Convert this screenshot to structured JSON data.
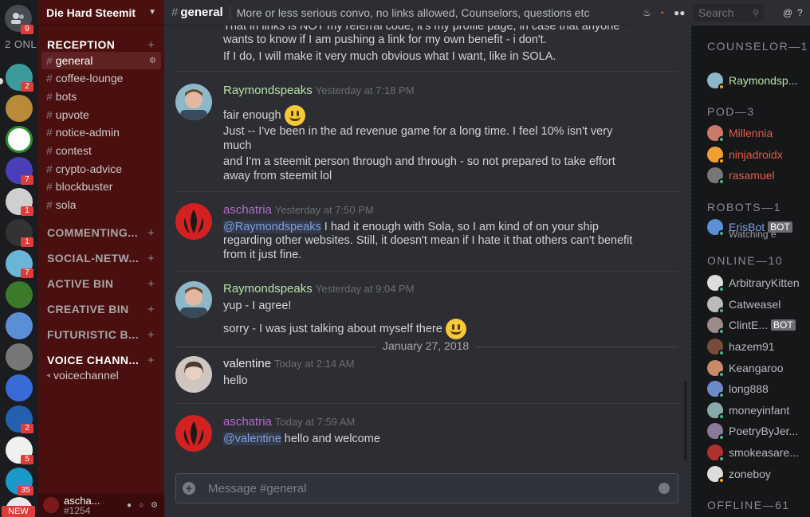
{
  "guilds": {
    "home_badge": "9",
    "online_label": "2 ONL",
    "new_label": "NEW",
    "items": [
      {
        "color": "#3d9b9b",
        "badge": "2"
      },
      {
        "color": "#b88a3a",
        "badge": ""
      },
      {
        "color": "#2a8f2a",
        "badge": ""
      },
      {
        "color": "#4a3fb8",
        "badge": "7"
      },
      {
        "color": "#cfcfcf",
        "badge": "1"
      },
      {
        "color": "#222222",
        "badge": "1"
      },
      {
        "color": "#6bb5d8",
        "badge": "7"
      },
      {
        "color": "#3a7a2a",
        "badge": ""
      },
      {
        "color": "#5a8fd8",
        "badge": ""
      },
      {
        "color": "#777",
        "badge": ""
      },
      {
        "color": "#3a6ad8",
        "badge": ""
      },
      {
        "color": "#2360b0",
        "badge": "2"
      },
      {
        "color": "#f0f0f0",
        "badge": "5"
      },
      {
        "color": "#1b9ac9",
        "badge": "35"
      },
      {
        "color": "#e8e8e8",
        "badge": ""
      }
    ]
  },
  "server": {
    "name": "Die Hard Steemit"
  },
  "categories": [
    {
      "label": "RECEPTION",
      "open": true
    },
    {
      "label": "COMMENTING..."
    },
    {
      "label": "SOCIAL-NETW..."
    },
    {
      "label": "ACTIVE BIN"
    },
    {
      "label": "CREATIVE BIN"
    },
    {
      "label": "FUTURISTIC B..."
    },
    {
      "label": "VOICE CHANN..."
    }
  ],
  "channels": [
    "general",
    "coffee-lounge",
    "bots",
    "upvote",
    "notice-admin",
    "contest",
    "crypto-advice",
    "blockbuster",
    "sola"
  ],
  "voice_channel": "voicechannel",
  "user": {
    "name": "ascha...",
    "disc": "#1254"
  },
  "header": {
    "channel": "general",
    "topic": "More or less serious convo, no links allowed, Counselors, questions etc",
    "search_placeholder": "Search"
  },
  "messages": {
    "m0": {
      "l1": "That in links is NOT my referral code, it's my profile page, in case that anyone",
      "l2": "wants to know if I am pushing a link for my own benefit - i don't.",
      "l3": "If I do, I will make it very much obvious what I want, like in SOLA."
    },
    "m1": {
      "author": "Raymondspeaks",
      "time": "Yesterday at 7:18 PM",
      "l1": "fair enough",
      "l2": "Just -- I've been in the ad revenue game for a long time. I feel 10% isn't very",
      "l3": "much",
      "l4": "and I'm a steemit person through and through - so not prepared to take effort",
      "l5": "away from steemit lol"
    },
    "m2": {
      "author": "aschatria",
      "time": "Yesterday at 7:50 PM",
      "mention": "@Raymondspeaks",
      "l1": " I had it enough with Sola, so I am kind of on your ship",
      "l2": "regarding other websites. Still, it doesn't mean if I hate it that others can't benefit",
      "l3": "from it just fine."
    },
    "m3": {
      "author": "Raymondspeaks",
      "time": "Yesterday at 9:04 PM",
      "l1": "yup - I agree!",
      "l2": "sorry - I was just talking about myself there"
    },
    "divider": "January 27, 2018",
    "m4": {
      "author": "valentine",
      "time": "Today at 2:14 AM",
      "l1": "hello"
    },
    "m5": {
      "author": "aschatria",
      "time": "Today at 7:59 AM",
      "mention": "@valentine",
      "l1": " hello and welcome"
    }
  },
  "composer": {
    "placeholder": "Message #general"
  },
  "members": {
    "counselor": "COUNSELOR—1",
    "pod": "POD—3",
    "robots": "ROBOTS—1",
    "online": "ONLINE—10",
    "offline": "OFFLINE—61",
    "bot_tag": "BOT",
    "list": {
      "c1": "Raymondsp...",
      "p1": "Millennia",
      "p2": "ninjadroidx",
      "p3": "rasamuel",
      "r1": "ErisBot",
      "r1_sub": "Watching e",
      "o1": "ArbitraryKitten",
      "o2": "Catweasel",
      "o3": "ClintE...",
      "o4": "hazem91",
      "o5": "Keangaroo",
      "o6": "long888",
      "o7": "moneyinfant",
      "o8": "PoetryByJer...",
      "o9": "smokeasare...",
      "o10": "zoneboy"
    },
    "colors": {
      "counselor": "#b9e1a6",
      "pod": "#e35d4b",
      "robot": "#7d9fe0",
      "online": "#b7b9bc"
    }
  }
}
